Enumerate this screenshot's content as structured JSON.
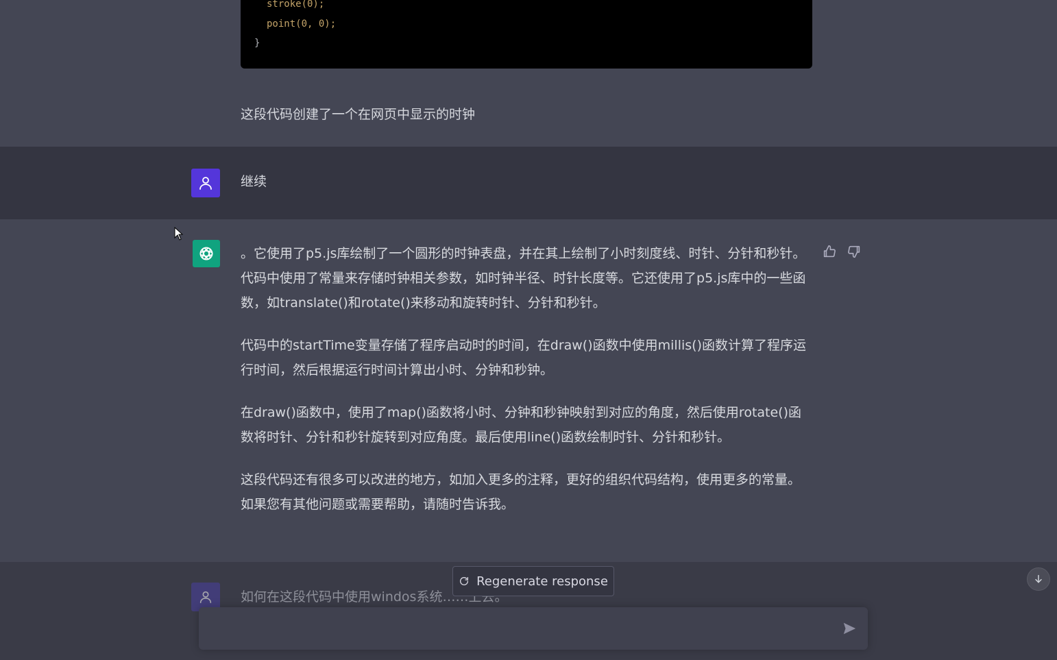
{
  "code_block": {
    "lines": [
      "stroke(0);",
      "point(0, 0);",
      "}"
    ]
  },
  "caption": "这段代码创建了一个在网页中显示的时钟",
  "user_message": "继续",
  "assistant_reply": {
    "paragraphs": [
      "。它使用了p5.js库绘制了一个圆形的时钟表盘，并在其上绘制了小时刻度线、时针、分针和秒针。代码中使用了常量来存储时钟相关参数，如时钟半径、时针长度等。它还使用了p5.js库中的一些函数，如translate()和rotate()来移动和旋转时针、分针和秒针。",
      "代码中的startTime变量存储了程序启动时的时间，在draw()函数中使用millis()函数计算了程序运行时间，然后根据运行时间计算出小时、分钟和秒钟。",
      "在draw()函数中，使用了map()函数将小时、分钟和秒钟映射到对应的角度，然后使用rotate()函数将时针、分针和秒针旋转到对应角度。最后使用line()函数绘制时针、分针和秒针。",
      "这段代码还有很多可以改进的地方，如加入更多的注释，更好的组织代码结构，使用更多的常量。如果您有其他问题或需要帮助，请随时告诉我。"
    ]
  },
  "next_user_message_partial": "如何在这段代码中使用windos系统……上去。",
  "regenerate_label": "Regenerate response",
  "input": {
    "value": "",
    "placeholder": ""
  },
  "icons": {
    "user_avatar": "user-icon",
    "assistant_avatar": "openai-logo-icon",
    "thumb_up": "thumbs-up-icon",
    "thumb_down": "thumbs-down-icon",
    "regenerate": "refresh-icon",
    "scroll_down": "arrow-down-icon",
    "send": "send-icon"
  },
  "colors": {
    "user_avatar_bg": "#5436da",
    "assistant_avatar_bg": "#10a37f",
    "user_section_bg": "#343541",
    "assistant_section_bg": "#444654"
  }
}
